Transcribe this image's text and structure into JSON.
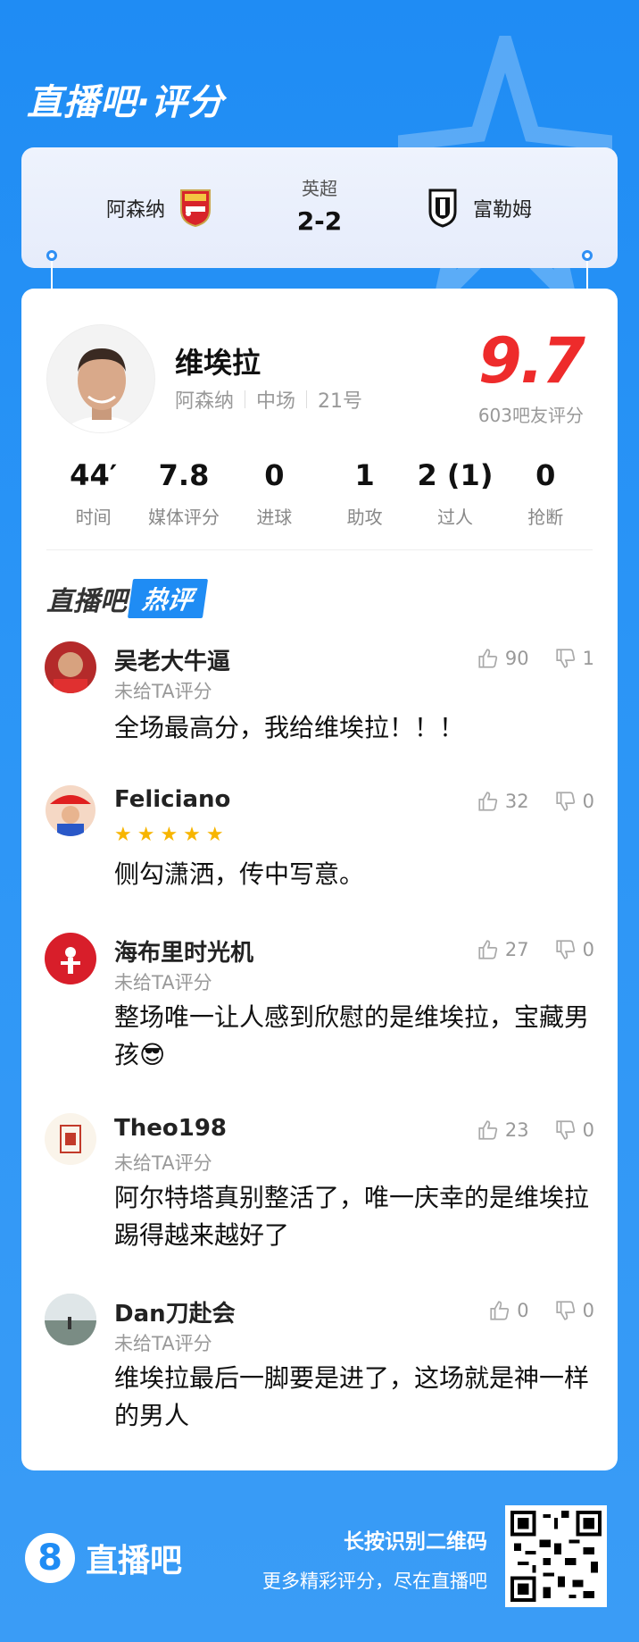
{
  "header": {
    "title": "直播吧·评分"
  },
  "match": {
    "home_team": "阿森纳",
    "away_team": "富勒姆",
    "league": "英超",
    "score": "2-2"
  },
  "player": {
    "name": "维埃拉",
    "team": "阿森纳",
    "position": "中场",
    "number": "21号",
    "rating": "9.7",
    "rating_count": "603吧友评分"
  },
  "stats": [
    {
      "value": "44′",
      "label": "时间"
    },
    {
      "value": "7.8",
      "label": "媒体评分"
    },
    {
      "value": "0",
      "label": "进球"
    },
    {
      "value": "1",
      "label": "助攻"
    },
    {
      "value": "2 (1)",
      "label": "过人"
    },
    {
      "value": "0",
      "label": "抢断"
    }
  ],
  "hot_section": {
    "brand": "直播吧",
    "tag": "热评"
  },
  "comments": [
    {
      "user": "吴老大牛逼",
      "sub": "未给TA评分",
      "likes": "90",
      "dislikes": "1",
      "text": "全场最高分，我给维埃拉！！！"
    },
    {
      "user": "Feliciano",
      "stars": "★★★★★",
      "likes": "32",
      "dislikes": "0",
      "text": "侧勾潇洒，传中写意。"
    },
    {
      "user": "海布里时光机",
      "sub": "未给TA评分",
      "likes": "27",
      "dislikes": "0",
      "text": "整场唯一让人感到欣慰的是维埃拉，宝藏男孩😎"
    },
    {
      "user": "Theo198",
      "sub": "未给TA评分",
      "likes": "23",
      "dislikes": "0",
      "text": "阿尔特塔真别整活了，唯一庆幸的是维埃拉踢得越来越好了"
    },
    {
      "user": "Dan刀赴会",
      "sub": "未给TA评分",
      "likes": "0",
      "dislikes": "0",
      "text": "维埃拉最后一脚要是进了，这场就是神一样的男人"
    }
  ],
  "footer": {
    "logo_mark": "8",
    "logo_text": "直播吧",
    "main": "长按识别二维码",
    "sub": "更多精彩评分，尽在直播吧"
  }
}
